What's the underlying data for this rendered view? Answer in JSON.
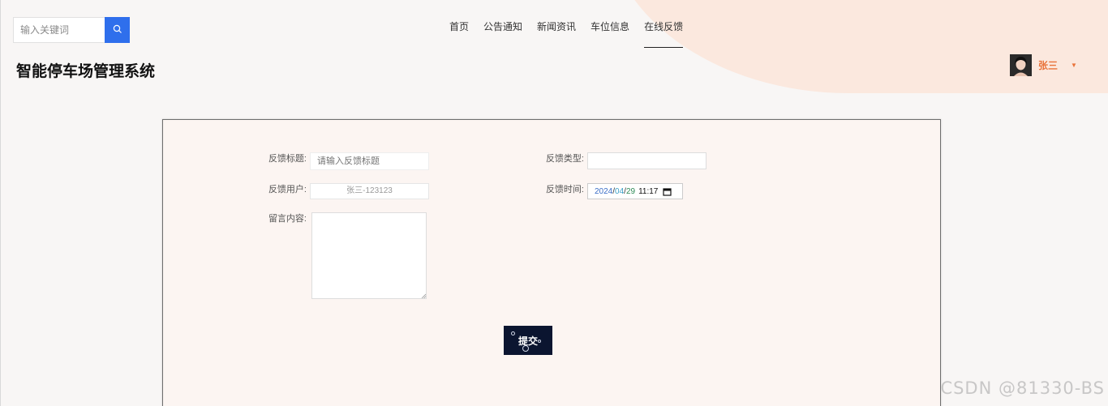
{
  "search": {
    "placeholder": "输入关键词",
    "icon": "search-icon"
  },
  "nav": {
    "items": [
      {
        "label": "首页",
        "active": false
      },
      {
        "label": "公告通知",
        "active": false
      },
      {
        "label": "新闻资讯",
        "active": false
      },
      {
        "label": "车位信息",
        "active": false
      },
      {
        "label": "在线反馈",
        "active": true
      }
    ]
  },
  "site": {
    "title": "智能停车场管理系统"
  },
  "user": {
    "name": "张三",
    "accent_color": "#e9733a"
  },
  "form": {
    "title_label": "反馈标题:",
    "title_placeholder": "请输入反馈标题",
    "type_label": "反馈类型:",
    "type_value": "",
    "user_label": "反馈用户:",
    "user_value": "张三-123123",
    "time_label": "反馈时间:",
    "time_year": "2024",
    "time_sep1": "/",
    "time_month": "04",
    "time_sep2": "/",
    "time_day": "29",
    "time_clock": "11:17",
    "content_label": "留言内容:",
    "content_value": "",
    "submit_label": "提交"
  },
  "colors": {
    "primary": "#2f6fec",
    "submit_bg": "#0b1530"
  },
  "watermark": "CSDN @81330-BS"
}
